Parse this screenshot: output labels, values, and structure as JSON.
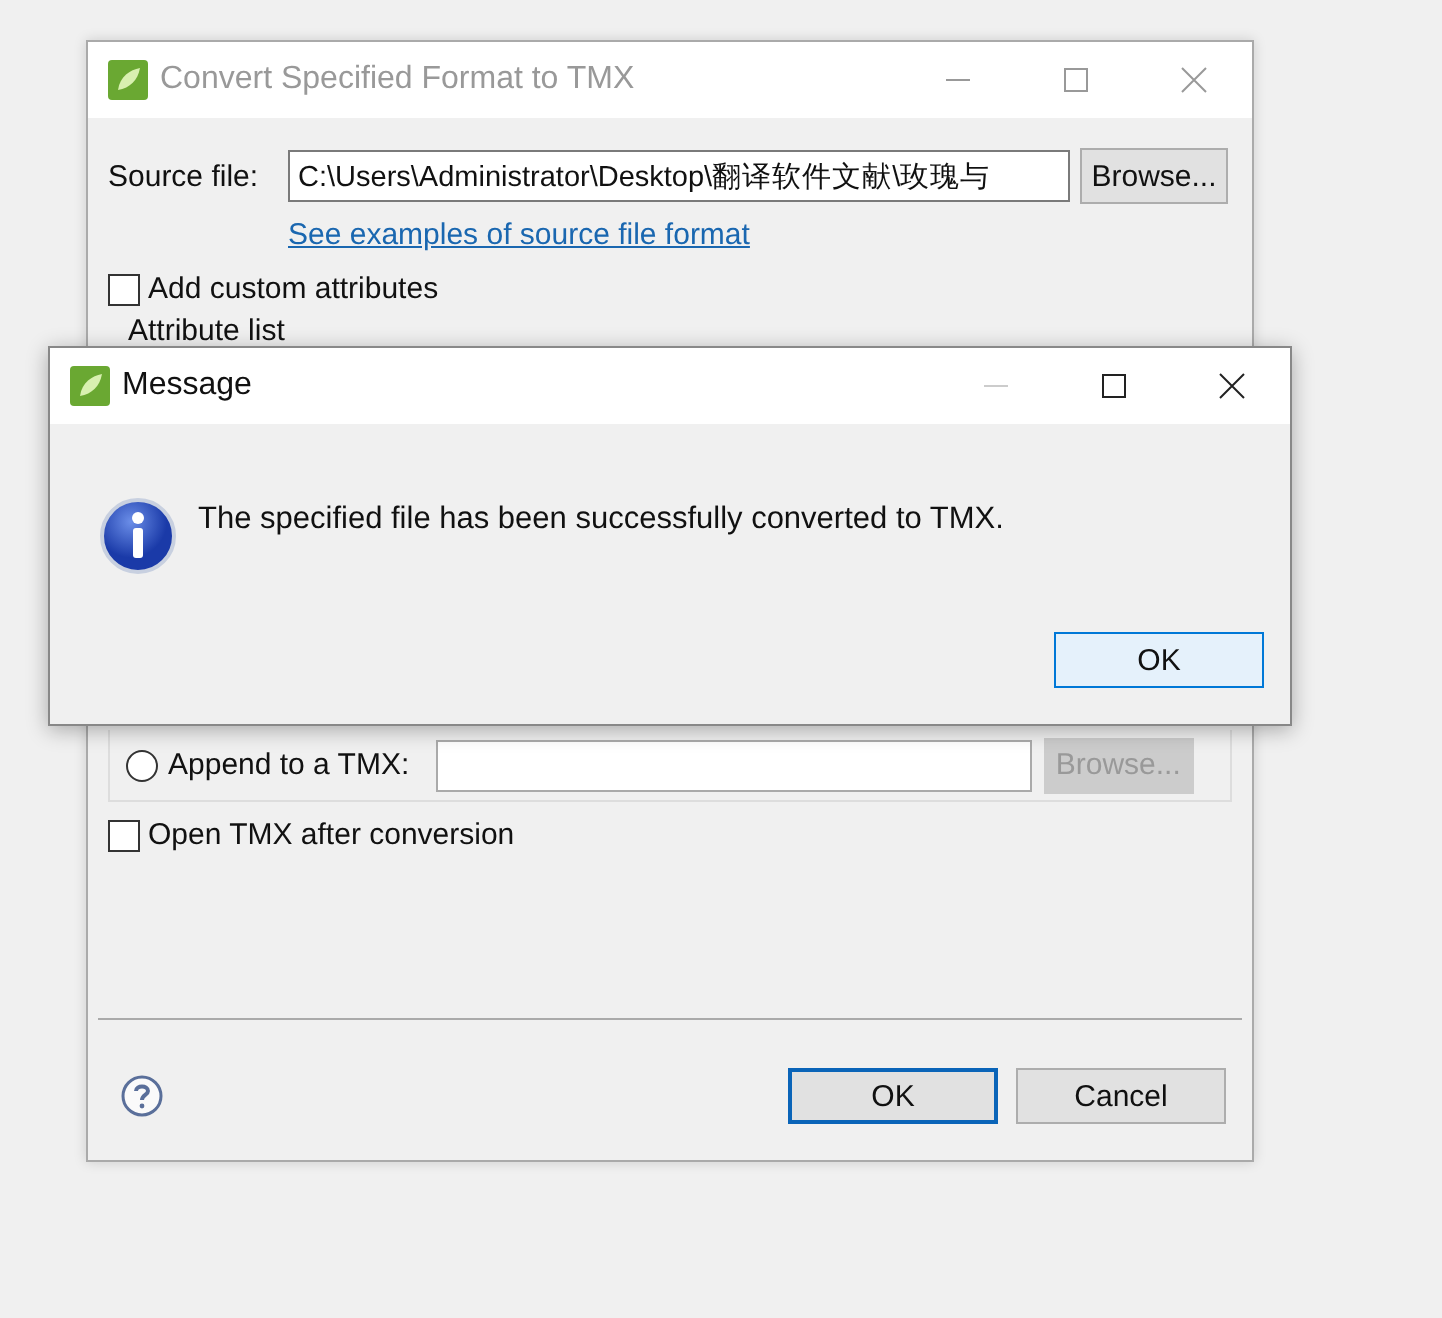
{
  "main_window": {
    "title": "Convert Specified Format to TMX",
    "active": false
  },
  "source_file": {
    "label": "Source file:",
    "value": "C:\\Users\\Administrator\\Desktop\\翻译软件文献\\玫瑰与",
    "browse": "Browse..."
  },
  "examples_link": "See examples of source file format",
  "add_custom_attributes": {
    "label": "Add custom attributes",
    "checked": false
  },
  "attribute_list_label": "Attribute list",
  "append": {
    "label": "Append to a TMX:",
    "selected": false,
    "browse": "Browse...",
    "browse_disabled": true
  },
  "open_after": {
    "label": "Open TMX after conversion",
    "checked": false
  },
  "buttons": [
    {
      "label": "OK",
      "default": true
    },
    {
      "label": "Cancel",
      "default": false
    }
  ],
  "message": {
    "title": "Message",
    "text": "The specified file has been successfully converted to TMX.",
    "button": "OK"
  }
}
